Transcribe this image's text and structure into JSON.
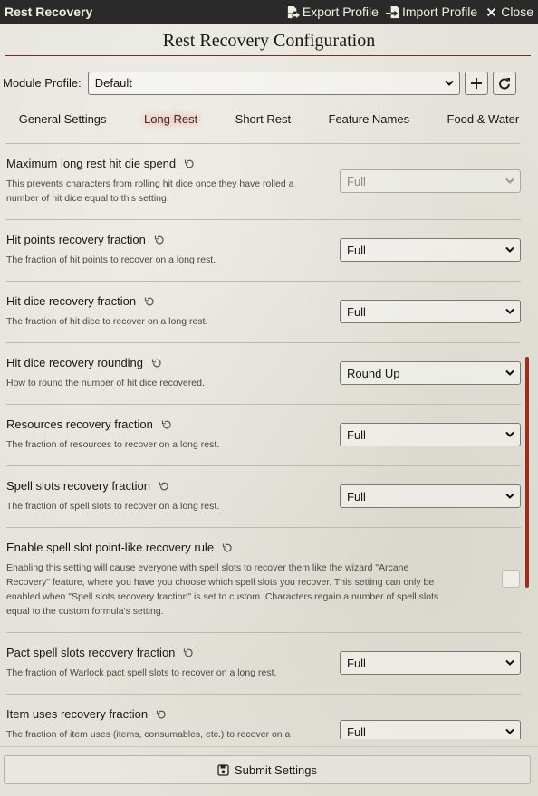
{
  "window": {
    "title": "Rest Recovery",
    "export_label": "Export Profile",
    "import_label": "Import Profile",
    "close_label": "Close"
  },
  "config_title": "Rest Recovery Configuration",
  "profile": {
    "label": "Module Profile:",
    "selected": "Default"
  },
  "tabs": [
    {
      "label": "General Settings",
      "active": false
    },
    {
      "label": "Long Rest",
      "active": true
    },
    {
      "label": "Short Rest",
      "active": false
    },
    {
      "label": "Feature Names",
      "active": false
    },
    {
      "label": "Food & Water",
      "active": false
    }
  ],
  "settings": [
    {
      "label": "Maximum long rest hit die spend",
      "hint_lines": [
        "This prevents characters from rolling hit dice once they have rolled a",
        "number of hit dice equal to this setting."
      ],
      "value": "Full",
      "disabled": true
    },
    {
      "label": "Hit points recovery fraction",
      "hint_lines": [
        "The fraction of hit points to recover on a long rest."
      ],
      "value": "Full"
    },
    {
      "label": "Hit dice recovery fraction",
      "hint_lines": [
        "The fraction of hit dice to recover on a long rest."
      ],
      "value": "Full"
    },
    {
      "label": "Hit dice recovery rounding",
      "hint_lines": [
        "How to round the number of hit dice recovered."
      ],
      "value": "Round Up"
    },
    {
      "label": "Resources recovery fraction",
      "hint_lines": [
        "The fraction of resources to recover on a long rest."
      ],
      "value": "Full"
    },
    {
      "label": "Spell slots recovery fraction",
      "hint_lines": [
        "The fraction of spell slots to recover on a long rest."
      ],
      "value": "Full"
    },
    {
      "label": "Enable spell slot point-like recovery rule",
      "hint_lines": [
        "Enabling this setting will cause everyone with spell slots to recover them like the wizard \"Arcane",
        "Recovery\" feature, where you have you choose which spell slots you recover. This setting can only be",
        "enabled when \"Spell slots recovery fraction\" is set to custom. Characters regain a number of spell slots",
        "equal to the custom formula's setting."
      ],
      "checked": false
    },
    {
      "label": "Pact spell slots recovery fraction",
      "hint_lines": [
        "The fraction of Warlock pact spell slots to recover on a long rest."
      ],
      "value": "Full"
    },
    {
      "label": "Item uses recovery fraction",
      "hint_lines": [
        "The fraction of item uses (items, consumables, etc.) to recover on a"
      ],
      "value": "Full"
    }
  ],
  "submit_label": "Submit Settings",
  "colors": {
    "accent": "#782e22",
    "scrollbar": "#9a2d1c",
    "titlebar": "#2a2a2a"
  }
}
